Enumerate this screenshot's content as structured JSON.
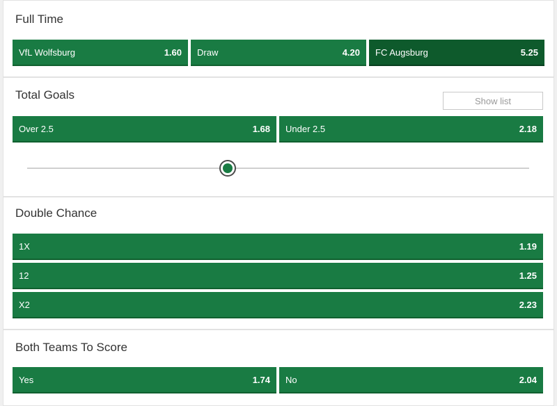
{
  "full_time": {
    "title": "Full Time",
    "options": [
      {
        "label": "VfL Wolfsburg",
        "odds": "1.60",
        "selected": false
      },
      {
        "label": "Draw",
        "odds": "4.20",
        "selected": false
      },
      {
        "label": "FC Augsburg",
        "odds": "5.25",
        "selected": true
      }
    ]
  },
  "total_goals": {
    "title": "Total Goals",
    "show_list_label": "Show list",
    "options": [
      {
        "label": "Over 2.5",
        "odds": "1.68"
      },
      {
        "label": "Under 2.5",
        "odds": "2.18"
      }
    ],
    "slider_position": 0.4
  },
  "double_chance": {
    "title": "Double Chance",
    "options": [
      {
        "label": "1X",
        "odds": "1.19"
      },
      {
        "label": "12",
        "odds": "1.25"
      },
      {
        "label": "X2",
        "odds": "2.23"
      }
    ]
  },
  "btts": {
    "title": "Both Teams To Score",
    "options": [
      {
        "label": "Yes",
        "odds": "1.74"
      },
      {
        "label": "No",
        "odds": "2.04"
      }
    ]
  },
  "colors": {
    "odds_button": "#197b43",
    "odds_button_selected": "#0e5a2c"
  }
}
